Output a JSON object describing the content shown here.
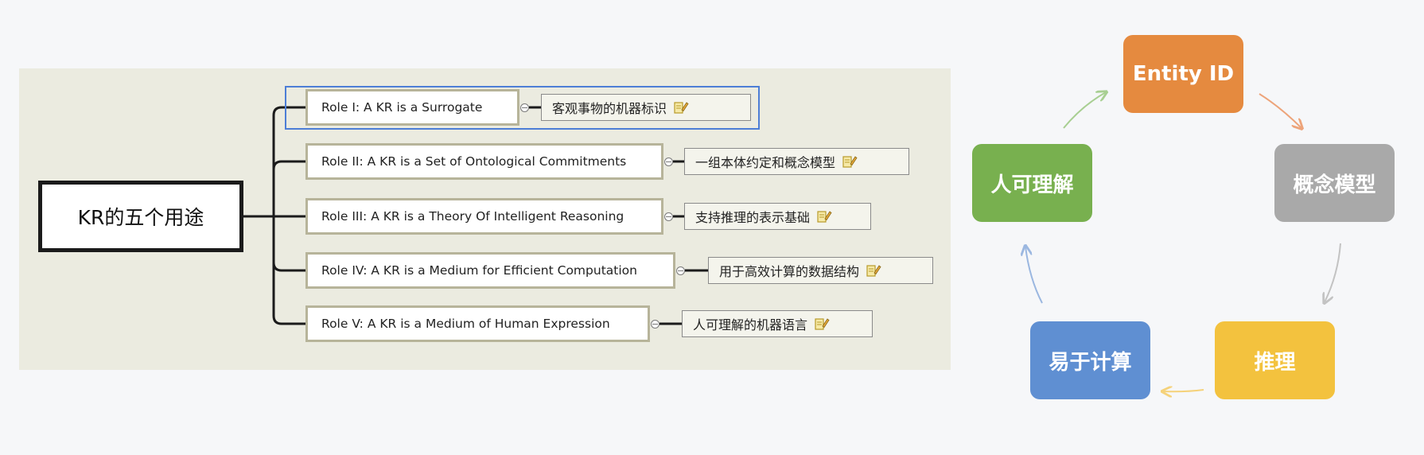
{
  "mindmap": {
    "root": "KR的五个用途",
    "roles": [
      {
        "label": "Role I: A KR is a Surrogate",
        "note": "客观事物的机器标识"
      },
      {
        "label": "Role II: A KR is a Set of Ontological Commitments",
        "note": "一组本体约定和概念模型"
      },
      {
        "label": "Role III: A KR is a Theory Of Intelligent Reasoning",
        "note": "支持推理的表示基础"
      },
      {
        "label": "Role IV: A KR is a Medium for Efficient Computation",
        "note": "用于高效计算的数据结构"
      },
      {
        "label": "Role V: A KR is a Medium of Human Expression",
        "note": "人可理解的机器语言"
      }
    ],
    "note_icon": "pencil-note-icon"
  },
  "cycle": {
    "nodes": [
      {
        "label": "Entity ID",
        "color": "#e58a3f"
      },
      {
        "label": "概念模型",
        "color": "#a9a9a9"
      },
      {
        "label": "推理",
        "color": "#f3c23e"
      },
      {
        "label": "易于计算",
        "color": "#5f8fd2"
      },
      {
        "label": "人可理解",
        "color": "#78b04f"
      }
    ]
  }
}
